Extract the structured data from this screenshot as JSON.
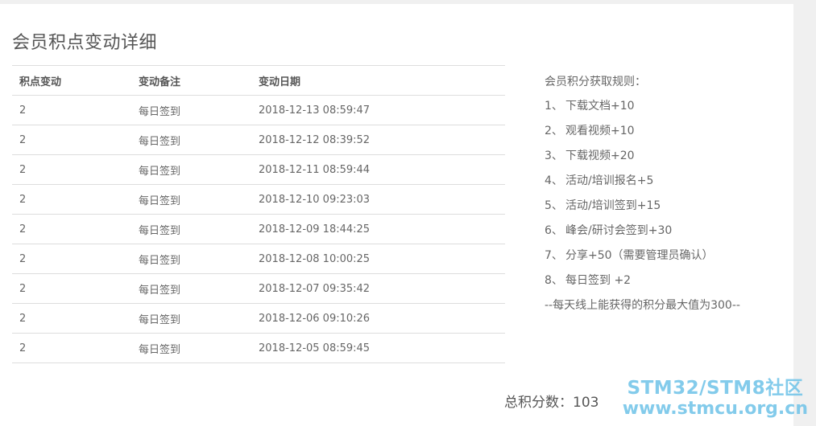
{
  "page": {
    "title": "会员积点变动详细"
  },
  "table": {
    "headers": [
      "积点变动",
      "变动备注",
      "变动日期"
    ],
    "rows": [
      [
        "2",
        "每日签到",
        "2018-12-13 08:59:47"
      ],
      [
        "2",
        "每日签到",
        "2018-12-12 08:39:52"
      ],
      [
        "2",
        "每日签到",
        "2018-12-11 08:59:44"
      ],
      [
        "2",
        "每日签到",
        "2018-12-10 09:23:03"
      ],
      [
        "2",
        "每日签到",
        "2018-12-09 18:44:25"
      ],
      [
        "2",
        "每日签到",
        "2018-12-08 10:00:25"
      ],
      [
        "2",
        "每日签到",
        "2018-12-07 09:35:42"
      ],
      [
        "2",
        "每日签到",
        "2018-12-06 09:10:26"
      ],
      [
        "2",
        "每日签到",
        "2018-12-05 08:59:45"
      ]
    ]
  },
  "rules": {
    "title": "会员积分获取规则：",
    "items": [
      {
        "num": "1、",
        "text": "下载文档+10"
      },
      {
        "num": "2、",
        "text": "观看视频+10"
      },
      {
        "num": "3、",
        "text": "下载视频+20"
      },
      {
        "num": "4、",
        "text": "活动/培训报名+5"
      },
      {
        "num": "5、",
        "text": "活动/培训签到+15"
      },
      {
        "num": "6、",
        "text": "峰会/研讨会签到+30"
      },
      {
        "num": "7、",
        "text": "分享+50（需要管理员确认）"
      },
      {
        "num": "8、",
        "text": "每日签到 +2"
      }
    ],
    "note": "--每天线上能获得的积分最大值为300--"
  },
  "total": {
    "label": "总积分数：",
    "value": "103"
  },
  "watermark": {
    "line1": "STM32/STM8社区",
    "line2": "www.stmcu.org.cn"
  }
}
